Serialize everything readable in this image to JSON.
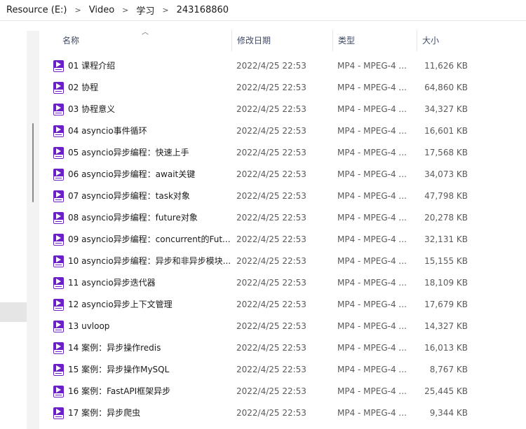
{
  "breadcrumb": [
    "Resource (E:)",
    "Video",
    "学习",
    "243168860"
  ],
  "columns": {
    "name": "名称",
    "date": "修改日期",
    "type": "类型",
    "size": "大小"
  },
  "files": [
    {
      "name": "01 课程介绍",
      "date": "2022/4/25 22:53",
      "type": "MP4 - MPEG-4 ...",
      "size": "11,626 KB"
    },
    {
      "name": "02 协程",
      "date": "2022/4/25 22:53",
      "type": "MP4 - MPEG-4 ...",
      "size": "64,860 KB"
    },
    {
      "name": "03 协程意义",
      "date": "2022/4/25 22:53",
      "type": "MP4 - MPEG-4 ...",
      "size": "34,327 KB"
    },
    {
      "name": "04 asyncio事件循环",
      "date": "2022/4/25 22:53",
      "type": "MP4 - MPEG-4 ...",
      "size": "16,601 KB"
    },
    {
      "name": "05 asyncio异步编程：快速上手",
      "date": "2022/4/25 22:53",
      "type": "MP4 - MPEG-4 ...",
      "size": "17,568 KB"
    },
    {
      "name": "06 asyncio异步编程：await关键",
      "date": "2022/4/25 22:53",
      "type": "MP4 - MPEG-4 ...",
      "size": "34,073 KB"
    },
    {
      "name": "07 asyncio异步编程：task对象",
      "date": "2022/4/25 22:53",
      "type": "MP4 - MPEG-4 ...",
      "size": "47,798 KB"
    },
    {
      "name": "08 asyncio异步编程：future对象",
      "date": "2022/4/25 22:53",
      "type": "MP4 - MPEG-4 ...",
      "size": "20,278 KB"
    },
    {
      "name": "09 asyncio异步编程：concurrent的Fut...",
      "date": "2022/4/25 22:53",
      "type": "MP4 - MPEG-4 ...",
      "size": "32,131 KB"
    },
    {
      "name": "10 asyncio异步编程：异步和非异步模块...",
      "date": "2022/4/25 22:53",
      "type": "MP4 - MPEG-4 ...",
      "size": "15,155 KB"
    },
    {
      "name": "11 asyncio异步迭代器",
      "date": "2022/4/25 22:53",
      "type": "MP4 - MPEG-4 ...",
      "size": "18,109 KB"
    },
    {
      "name": "12 asyncio异步上下文管理",
      "date": "2022/4/25 22:53",
      "type": "MP4 - MPEG-4 ...",
      "size": "17,679 KB"
    },
    {
      "name": "13 uvloop",
      "date": "2022/4/25 22:53",
      "type": "MP4 - MPEG-4 ...",
      "size": "14,327 KB"
    },
    {
      "name": "14 案例：异步操作redis",
      "date": "2022/4/25 22:53",
      "type": "MP4 - MPEG-4 ...",
      "size": "16,013 KB"
    },
    {
      "name": "15 案例：异步操作MySQL",
      "date": "2022/4/25 22:53",
      "type": "MP4 - MPEG-4 ...",
      "size": "8,767 KB"
    },
    {
      "name": "16 案例：FastAPI框架异步",
      "date": "2022/4/25 22:53",
      "type": "MP4 - MPEG-4 ...",
      "size": "25,445 KB"
    },
    {
      "name": "17 案例：异步爬虫",
      "date": "2022/4/25 22:53",
      "type": "MP4 - MPEG-4 ...",
      "size": "9,344 KB"
    }
  ],
  "icons": {
    "file": "mp4-video-file-icon",
    "sort": "sort-ascending-icon",
    "separator": "chevron-right-icon"
  },
  "colors": {
    "icon_purple": "#6a1fc8",
    "header_text": "#3f4a66",
    "selected_nav": "#e5e5e5"
  }
}
